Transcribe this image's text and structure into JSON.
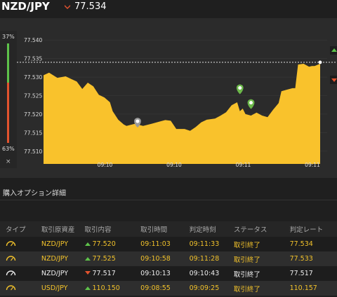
{
  "header": {
    "pair": "NZD/JPY",
    "price": "77.534",
    "direction_icon": "down-arrow-icon"
  },
  "sidebar": {
    "up_pct": "37%",
    "down_pct": "63%",
    "close": "×"
  },
  "chart_data": {
    "type": "area",
    "color": "#f9c22c",
    "y_ticks": [
      "77.540",
      "77.535",
      "77.530",
      "77.525",
      "77.520",
      "77.515",
      "77.510"
    ],
    "x_ticks": [
      "09:10",
      "09:10",
      "09:11",
      "09:11"
    ],
    "current_price": 77.534,
    "markers": [
      {
        "type": "low",
        "value": 77.516
      },
      {
        "type": "high",
        "value": 77.525
      },
      {
        "type": "high",
        "value": 77.521
      }
    ]
  },
  "section": {
    "title": "購入オプション詳細"
  },
  "table": {
    "headers": [
      "タイプ",
      "取引原資産",
      "取引内容",
      "取引時間",
      "判定時刻",
      "ステータス",
      "判定レート"
    ],
    "rows": [
      {
        "asset": "NZD/JPY",
        "dir": "up",
        "content": "77.520",
        "time": "09:11:03",
        "judge": "09:11:33",
        "status": "取引終了",
        "rate": "77.534",
        "highlight": true
      },
      {
        "asset": "NZD/JPY",
        "dir": "up",
        "content": "77.525",
        "time": "09:10:58",
        "judge": "09:11:28",
        "status": "取引終了",
        "rate": "77.533",
        "highlight": true
      },
      {
        "asset": "NZD/JPY",
        "dir": "down",
        "content": "77.517",
        "time": "09:10:13",
        "judge": "09:10:43",
        "status": "取引終了",
        "rate": "77.517",
        "highlight": false
      },
      {
        "asset": "USD/JPY",
        "dir": "up",
        "content": "110.150",
        "time": "09:08:55",
        "judge": "09:09:25",
        "status": "取引終了",
        "rate": "110.157",
        "highlight": true
      }
    ]
  }
}
